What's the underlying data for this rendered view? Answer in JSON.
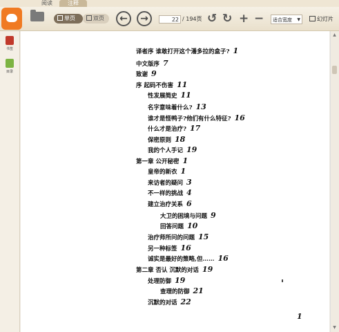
{
  "tabs": [
    {
      "label": "阅读",
      "active": false
    },
    {
      "label": "注释",
      "active": true
    }
  ],
  "toolbar": {
    "single_page": "单页",
    "double_page": "双页",
    "page_current": "22",
    "page_total": "/ 194页",
    "zoom_mode": "适合宽度",
    "slideshow": "幻灯片"
  },
  "sidebar": {
    "bookmark": "书签",
    "toc": "目录"
  },
  "toc": {
    "entries": [
      {
        "text": "译者序  谁敢打开这个潘多拉的盒子?",
        "page": "1",
        "indent": 0
      },
      {
        "text": "中文版序",
        "page": "7",
        "indent": 0
      },
      {
        "text": "致谢",
        "page": "9",
        "indent": 0
      },
      {
        "text": "序  起码不伤害",
        "page": "11",
        "indent": 0
      },
      {
        "text": "性发展简史",
        "page": "11",
        "indent": 1
      },
      {
        "text": "名字意味着什么?",
        "page": "13",
        "indent": 1
      },
      {
        "text": "谁才是怪鸭子?他们有什么特征?",
        "page": "16",
        "indent": 1
      },
      {
        "text": "什么才是治疗?",
        "page": "17",
        "indent": 1
      },
      {
        "text": "保密原则",
        "page": "18",
        "indent": 1
      },
      {
        "text": "我的个人手记",
        "page": "19",
        "indent": 1
      },
      {
        "text": "第一章  公开秘密",
        "page": "1",
        "indent": 0
      },
      {
        "text": "皇帝的新衣",
        "page": "1",
        "indent": 1
      },
      {
        "text": "来访者的疑问",
        "page": "3",
        "indent": 1
      },
      {
        "text": "不一样的挑战",
        "page": "4",
        "indent": 1
      },
      {
        "text": "建立治疗关系",
        "page": "6",
        "indent": 1
      },
      {
        "text": "大卫的困境与问题",
        "page": "9",
        "indent": 2
      },
      {
        "text": "回答问题",
        "page": "10",
        "indent": 2
      },
      {
        "text": "治疗师所问的问题",
        "page": "15",
        "indent": 1
      },
      {
        "text": "另一种标签",
        "page": "16",
        "indent": 1
      },
      {
        "text": "诚实是最好的策略,但……",
        "page": "16",
        "indent": 1
      },
      {
        "text": "第二章  否认  沉默的对话",
        "page": "19",
        "indent": 0
      },
      {
        "text": "处理防御",
        "page": "19",
        "indent": 1
      },
      {
        "text": "查理的防御",
        "page": "21",
        "indent": 2
      },
      {
        "text": "沉默的对话",
        "page": "22",
        "indent": 1
      }
    ],
    "footer_page": "1"
  },
  "colors": {
    "accent": "#f07a22",
    "toolbar_bg": "#efe6d4",
    "active_tab": "#c9b899",
    "bookmark_icon": "#c0392b",
    "toc_icon": "#7cb342"
  }
}
